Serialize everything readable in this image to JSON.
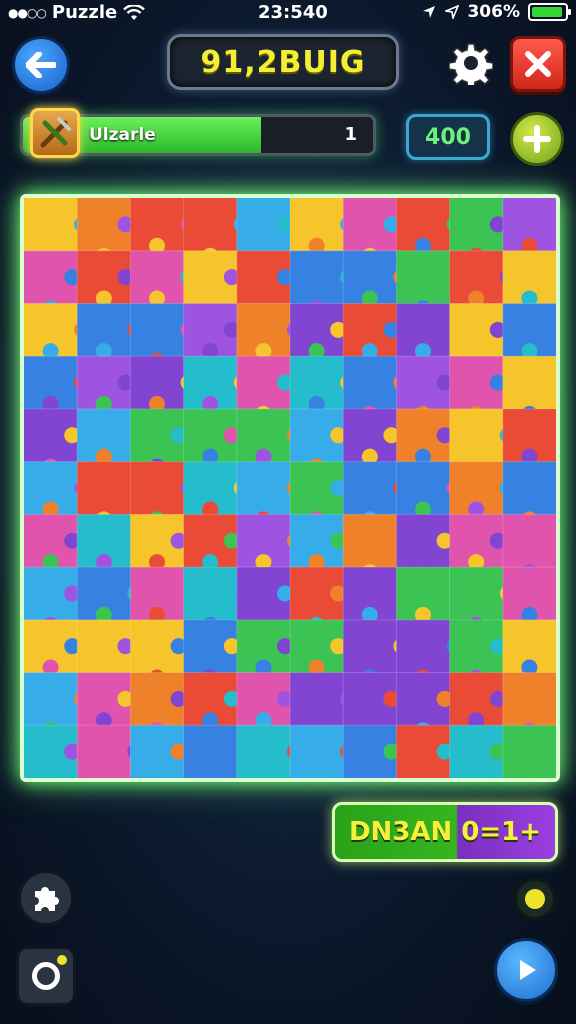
{
  "status_bar": {
    "carrier": "Puzzle",
    "time": "23:540",
    "battery": "306%",
    "signal_dots": "●●○○",
    "icons": [
      "wifi-icon",
      "location-icon",
      "battery-icon"
    ]
  },
  "header": {
    "score": "91,2BUIG",
    "icons": [
      "back-arrow-icon",
      "gear-icon",
      "close-icon"
    ]
  },
  "progress": {
    "label": "Ulzarle",
    "count": "1",
    "fill_percent": 68,
    "tool_icon": "pickaxe-icon"
  },
  "coins": {
    "value": "400",
    "add_icon": "plus-icon"
  },
  "board": {
    "rows": 11,
    "cols": 10,
    "palette": [
      "#7a3ad0",
      "#2aa8e8",
      "#e8402a",
      "#2fc04a",
      "#f5c21e",
      "#f07a1e",
      "#e04aa8",
      "#2a7ae0",
      "#9a4ae0",
      "#18b8c8"
    ]
  },
  "level_badge": {
    "text": "DN3AN 0=1+"
  },
  "bottom": {
    "icons": [
      "puzzle-piece-icon",
      "rotate-icon",
      "play-icon",
      "dot-indicator-icon"
    ]
  },
  "colors": {
    "background": "#0c1a2e",
    "board_glow": "#6cff6c",
    "score_text": "#f2ef35",
    "accent_blue": "#1a62c9",
    "close_red": "#d1261b"
  }
}
